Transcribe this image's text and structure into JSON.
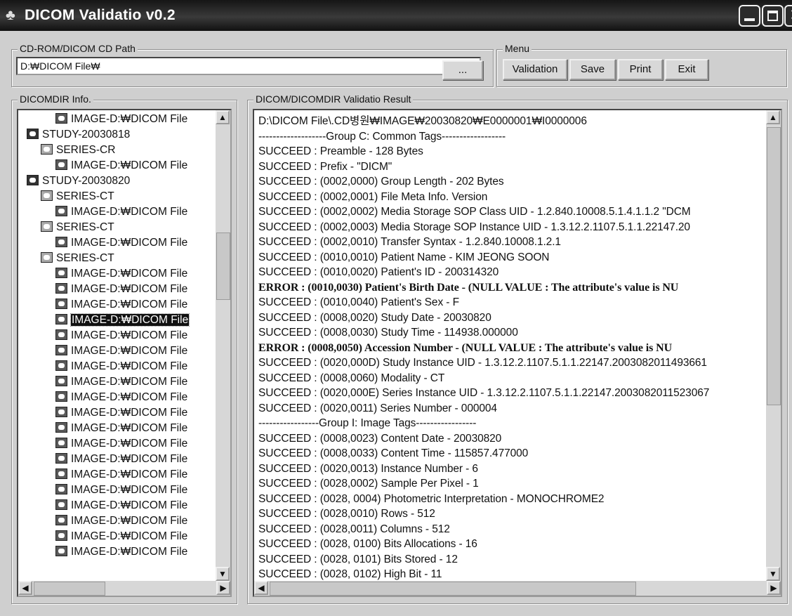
{
  "window": {
    "title": "DICOM Validatio v0.2",
    "icons": {
      "app": "app-icon",
      "minimize": "minimize-icon",
      "maximize": "maximize-icon",
      "close": "close-icon"
    }
  },
  "path_group": {
    "label": "CD-ROM/DICOM CD Path",
    "value": "D:₩DICOM File₩",
    "browse_label": "..."
  },
  "menu": {
    "label": "Menu",
    "buttons": [
      "Validation",
      "Save",
      "Print",
      "Exit"
    ]
  },
  "tree": {
    "label": "DICOMDIR Info.",
    "items": [
      {
        "type": "image",
        "label": "IMAGE-D:₩DICOM File"
      },
      {
        "type": "study",
        "label": "STUDY-20030818"
      },
      {
        "type": "series",
        "label": "SERIES-CR"
      },
      {
        "type": "image",
        "label": "IMAGE-D:₩DICOM File"
      },
      {
        "type": "study",
        "label": "STUDY-20030820"
      },
      {
        "type": "series",
        "label": "SERIES-CT"
      },
      {
        "type": "image",
        "label": "IMAGE-D:₩DICOM File"
      },
      {
        "type": "series",
        "label": "SERIES-CT"
      },
      {
        "type": "image",
        "label": "IMAGE-D:₩DICOM File"
      },
      {
        "type": "series",
        "label": "SERIES-CT"
      },
      {
        "type": "image",
        "label": "IMAGE-D:₩DICOM File"
      },
      {
        "type": "image",
        "label": "IMAGE-D:₩DICOM File"
      },
      {
        "type": "image",
        "label": "IMAGE-D:₩DICOM File"
      },
      {
        "type": "image",
        "label": "IMAGE-D:₩DICOM File",
        "selected": true
      },
      {
        "type": "image",
        "label": "IMAGE-D:₩DICOM File"
      },
      {
        "type": "image",
        "label": "IMAGE-D:₩DICOM File"
      },
      {
        "type": "image",
        "label": "IMAGE-D:₩DICOM File"
      },
      {
        "type": "image",
        "label": "IMAGE-D:₩DICOM File"
      },
      {
        "type": "image",
        "label": "IMAGE-D:₩DICOM File"
      },
      {
        "type": "image",
        "label": "IMAGE-D:₩DICOM File"
      },
      {
        "type": "image",
        "label": "IMAGE-D:₩DICOM File"
      },
      {
        "type": "image",
        "label": "IMAGE-D:₩DICOM File"
      },
      {
        "type": "image",
        "label": "IMAGE-D:₩DICOM File"
      },
      {
        "type": "image",
        "label": "IMAGE-D:₩DICOM File"
      },
      {
        "type": "image",
        "label": "IMAGE-D:₩DICOM File"
      },
      {
        "type": "image",
        "label": "IMAGE-D:₩DICOM File"
      },
      {
        "type": "image",
        "label": "IMAGE-D:₩DICOM File"
      },
      {
        "type": "image",
        "label": "IMAGE-D:₩DICOM File"
      },
      {
        "type": "image",
        "label": "IMAGE-D:₩DICOM File"
      }
    ]
  },
  "results": {
    "label": "DICOM/DICOMDIR Validatio Result",
    "lines": [
      {
        "text": "D:\\DICOM File\\.CD병원₩IMAGE₩20030820₩E0000001₩I0000006",
        "status": "path"
      },
      {
        "text": "-------------------Group C: Common Tags------------------",
        "status": "header"
      },
      {
        "text": "SUCCEED : Preamble - 128 Bytes",
        "status": "ok"
      },
      {
        "text": "SUCCEED : Prefix - \"DICM\"",
        "status": "ok"
      },
      {
        "text": "SUCCEED : (0002,0000) Group Length - 202 Bytes",
        "status": "ok"
      },
      {
        "text": "SUCCEED : (0002,0001) File Meta Info. Version",
        "status": "ok"
      },
      {
        "text": "SUCCEED : (0002,0002) Media Storage SOP Class UID - 1.2.840.10008.5.1.4.1.1.2  \"DCM",
        "status": "ok"
      },
      {
        "text": "SUCCEED : (0002,0003) Media Storage SOP Instance UID - 1.3.12.2.1107.5.1.1.22147.20",
        "status": "ok"
      },
      {
        "text": "SUCCEED : (0002,0010) Transfer Syntax - 1.2.840.10008.1.2.1",
        "status": "ok"
      },
      {
        "text": "SUCCEED : (0010,0010) Patient Name - KIM JEONG SOON",
        "status": "ok"
      },
      {
        "text": "SUCCEED : (0010,0020) Patient's ID - 200314320",
        "status": "ok"
      },
      {
        "text": "ERROR    : (0010,0030) Patient's Birth Date - (NULL VALUE : The attribute's value is NU",
        "status": "error"
      },
      {
        "text": "SUCCEED : (0010,0040) Patient's Sex - F",
        "status": "ok"
      },
      {
        "text": "SUCCEED : (0008,0020) Study Date - 20030820",
        "status": "ok"
      },
      {
        "text": "SUCCEED : (0008,0030) Study Time - 114938.000000",
        "status": "ok"
      },
      {
        "text": "ERROR    : (0008,0050) Accession Number - (NULL VALUE : The attribute's value is NU",
        "status": "error"
      },
      {
        "text": "SUCCEED : (0020,000D) Study Instance UID - 1.3.12.2.1107.5.1.1.22147.2003082011493661",
        "status": "ok"
      },
      {
        "text": "SUCCEED : (0008,0060) Modality - CT",
        "status": "ok"
      },
      {
        "text": "SUCCEED : (0020,000E) Series Instance UID - 1.3.12.2.1107.5.1.1.22147.2003082011523067",
        "status": "ok"
      },
      {
        "text": "SUCCEED : (0020,0011) Series Number - 000004",
        "status": "ok"
      },
      {
        "text": "-----------------Group I: Image Tags-----------------",
        "status": "header"
      },
      {
        "text": "SUCCEED : (0008,0023) Content Date - 20030820",
        "status": "ok"
      },
      {
        "text": "SUCCEED : (0008,0033) Content Time - 115857.477000",
        "status": "ok"
      },
      {
        "text": "SUCCEED : (0020,0013) Instance Number - 6",
        "status": "ok"
      },
      {
        "text": "SUCCEED : (0028,0002) Sample Per Pixel - 1",
        "status": "ok"
      },
      {
        "text": "SUCCEED : (0028, 0004) Photometric Interpretation - MONOCHROME2",
        "status": "ok"
      },
      {
        "text": "SUCCEED : (0028,0010) Rows - 512",
        "status": "ok"
      },
      {
        "text": "SUCCEED : (0028,0011) Columns - 512",
        "status": "ok"
      },
      {
        "text": "SUCCEED : (0028, 0100) Bits Allocations - 16",
        "status": "ok"
      },
      {
        "text": "SUCCEED : (0028, 0101) Bits Stored - 12",
        "status": "ok"
      },
      {
        "text": "SUCCEED : (0028, 0102) High Bit - 11",
        "status": "ok"
      }
    ]
  }
}
